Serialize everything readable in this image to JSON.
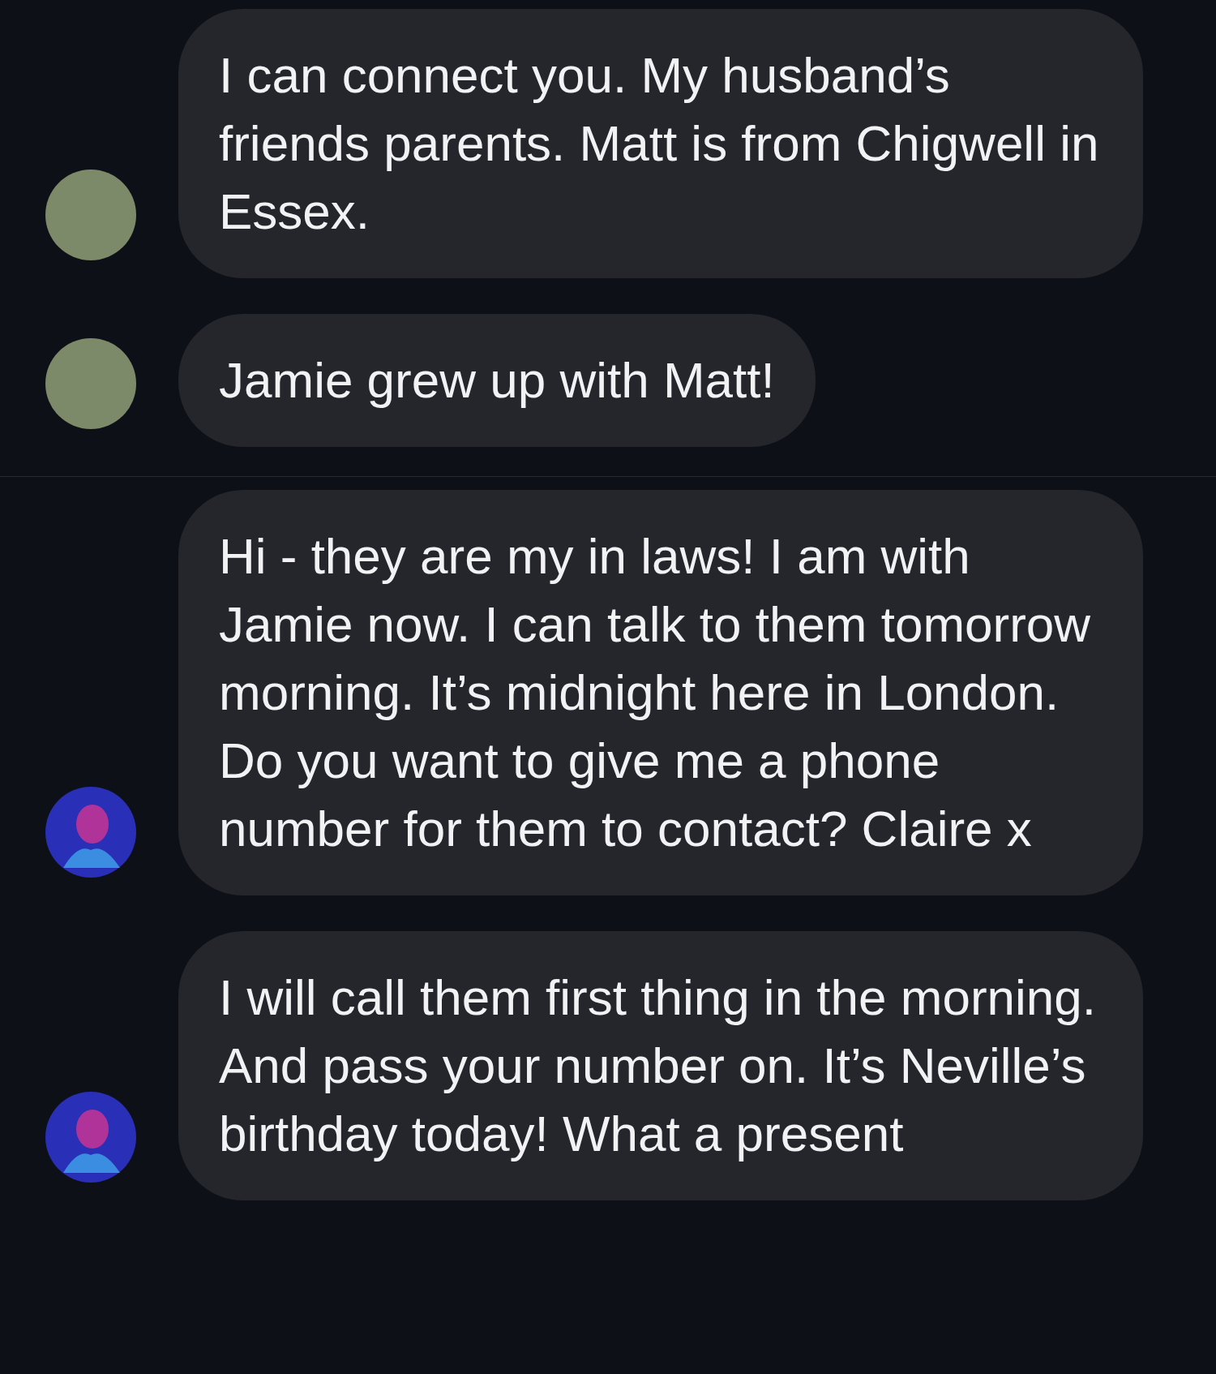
{
  "groups": [
    {
      "messages": [
        {
          "text": "I can connect you. My husband’s friends parents. Matt is from Chigwell in Essex.",
          "kind": "photo"
        },
        {
          "text": "Jamie grew up with Matt!",
          "kind": "photo"
        }
      ]
    },
    {
      "messages": [
        {
          "text": "Hi - they are my in laws! I am with Jamie now. I can talk to them tomorrow morning. It’s midnight here in London. Do you want to give me a phone number for them to contact? Claire x",
          "kind": "illustration"
        },
        {
          "text": "I will call them first thing in the morning. And pass your number on. It’s Neville’s birthday today! What a present",
          "kind": "illustration"
        }
      ]
    }
  ]
}
